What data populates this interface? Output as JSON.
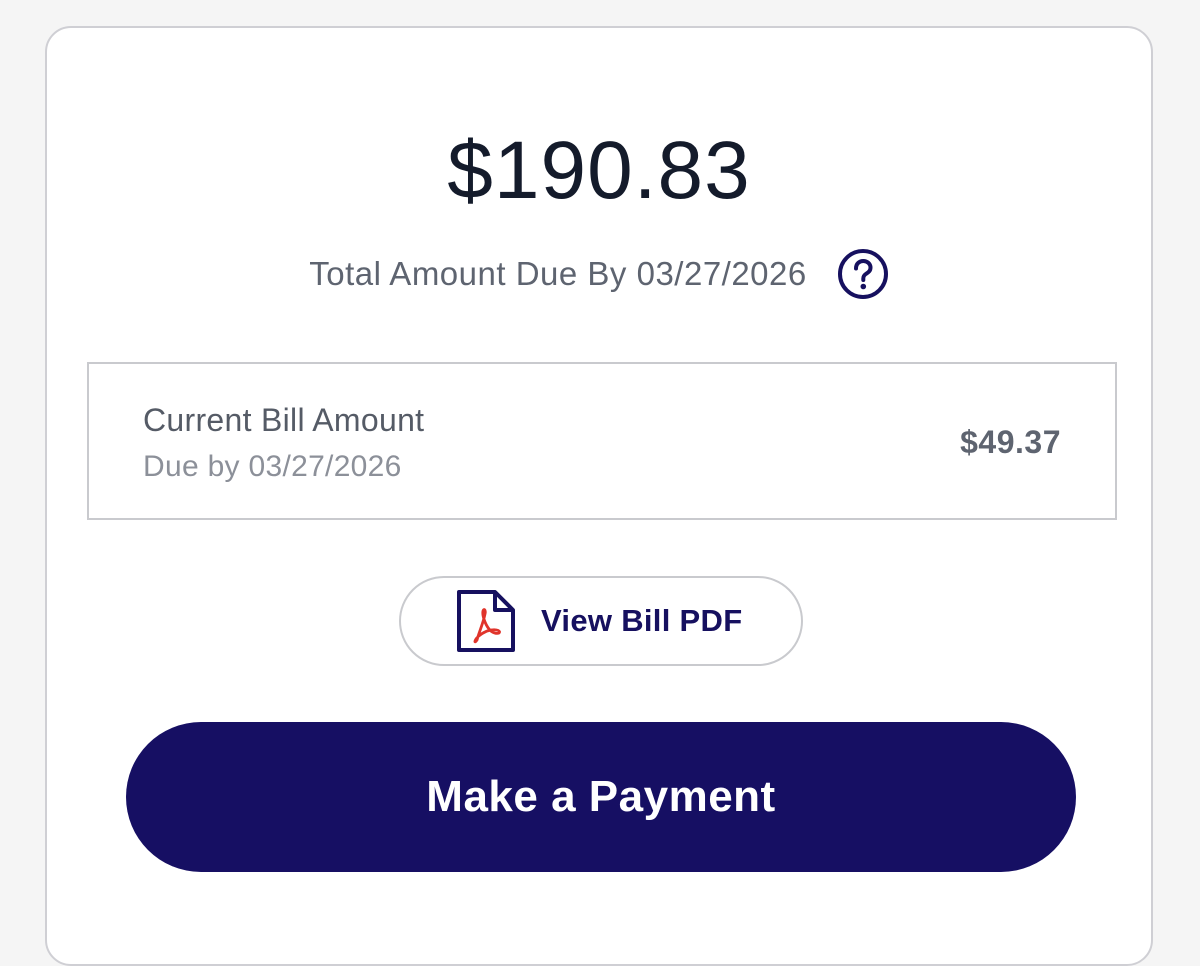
{
  "summary": {
    "total_amount": "$190.83",
    "due_label": "Total Amount Due By 03/27/2026"
  },
  "current_bill": {
    "title": "Current Bill Amount",
    "due_text": "Due by 03/27/2026",
    "amount": "$49.37"
  },
  "actions": {
    "view_pdf_label": "View Bill PDF",
    "pay_label": "Make a Payment"
  },
  "icons": {
    "help": "question-circle-icon",
    "pdf": "pdf-document-icon"
  },
  "colors": {
    "brand_navy": "#160f63",
    "text_dark": "#141b2b",
    "text_muted": "#5e6470",
    "border": "#c9cace"
  }
}
